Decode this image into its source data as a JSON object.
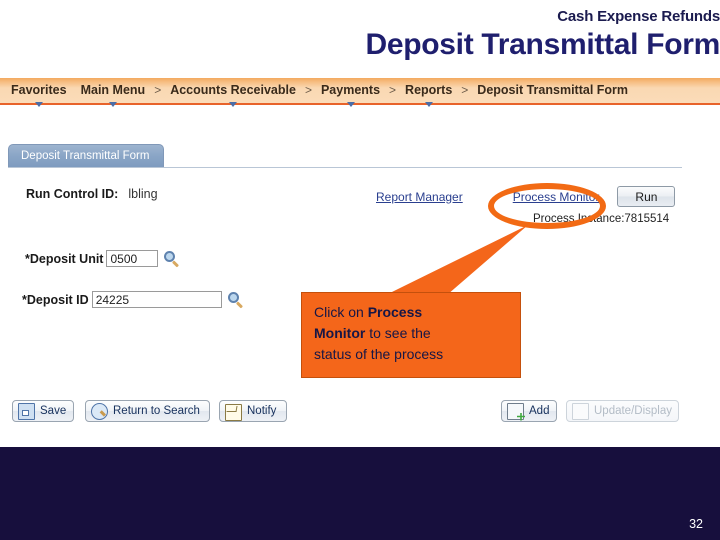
{
  "slide": {
    "subtitle": "Cash Expense Refunds",
    "title": "Deposit Transmittal Form",
    "page_number": "32",
    "footer_color": "#170f3d",
    "accent_color": "#f4661a"
  },
  "navbar": {
    "items": [
      {
        "label": "Favorites",
        "caret": true,
        "separator_after": false
      },
      {
        "label": "Main Menu",
        "caret": true,
        "separator_after": true
      },
      {
        "label": "Accounts Receivable",
        "caret": true,
        "separator_after": true
      },
      {
        "label": "Payments",
        "caret": true,
        "separator_after": true
      },
      {
        "label": "Reports",
        "caret": true,
        "separator_after": true
      },
      {
        "label": "Deposit Transmittal Form",
        "caret": false,
        "separator_after": false
      }
    ],
    "separator_glyph": ">"
  },
  "page_tab": {
    "label": "Deposit Transmittal Form"
  },
  "form": {
    "run_control_label": "Run Control ID:",
    "run_control_value": "lbling",
    "deposit_unit_label": "*Deposit Unit",
    "deposit_unit_value": "0500",
    "deposit_unit_placeholder": "",
    "deposit_id_label": "*Deposit ID",
    "deposit_id_value": "24225",
    "deposit_id_placeholder": "",
    "lookup_icon": "magnifier-icon"
  },
  "actions": {
    "report_manager_link": "Report Manager",
    "process_monitor_link": "Process Monitor",
    "run_button": "Run",
    "process_instance": "Process Instance:7815514"
  },
  "toolbar": {
    "save_label": "Save",
    "save_icon": "floppy-disk-icon",
    "return_label": "Return to Search",
    "return_icon": "search-icon",
    "notify_label": "Notify",
    "notify_icon": "envelope-icon",
    "add_label": "Add",
    "add_icon": "add-document-icon",
    "update_label": "Update/Display",
    "update_icon": "document-icon"
  },
  "annotation": {
    "line1_prefix": "Click on ",
    "line1_bold": "Process",
    "line2_bold": "Monitor",
    "line2_suffix": " to see the",
    "line3": "status of the process"
  }
}
